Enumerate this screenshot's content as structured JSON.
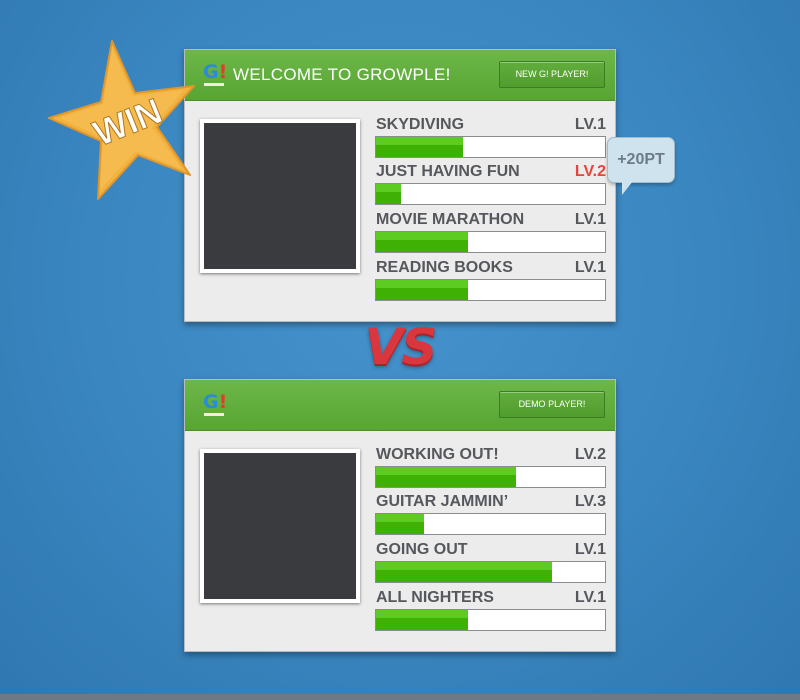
{
  "top_card": {
    "title": "WELCOME TO GROWPLE!",
    "button_label": "NEW G! PLAYER!",
    "skills": [
      {
        "name": "SKYDIVING",
        "level": "LV.1",
        "progress": 0.38,
        "leveled_up": false
      },
      {
        "name": "JUST HAVING FUN",
        "level": "LV.2",
        "progress": 0.11,
        "leveled_up": true
      },
      {
        "name": "MOVIE MARATHON",
        "level": "LV.1",
        "progress": 0.4,
        "leveled_up": false
      },
      {
        "name": "READING BOOKS",
        "level": "LV.1",
        "progress": 0.4,
        "leveled_up": false
      }
    ]
  },
  "bottom_card": {
    "button_label": "DEMO PLAYER!",
    "skills": [
      {
        "name": "WORKING OUT!",
        "level": "LV.2",
        "progress": 0.61,
        "leveled_up": false
      },
      {
        "name": "GUITAR JAMMIN’",
        "level": "LV.3",
        "progress": 0.21,
        "leveled_up": false
      },
      {
        "name": "GOING OUT",
        "level": "LV.1",
        "progress": 0.77,
        "leveled_up": false
      },
      {
        "name": "ALL NIGHTERS",
        "level": "LV.1",
        "progress": 0.4,
        "leveled_up": false
      }
    ]
  },
  "logo": {
    "g": "G",
    "bang": "!"
  },
  "win_badge": "WIN",
  "points_bubble": "+20PT",
  "versus": "VS",
  "colors": {
    "background": "#3a86c0",
    "header_green": "#58a533",
    "progress_green": "#3fb004",
    "level_up_red": "#e8443b",
    "star_gold": "#f2b23f"
  }
}
